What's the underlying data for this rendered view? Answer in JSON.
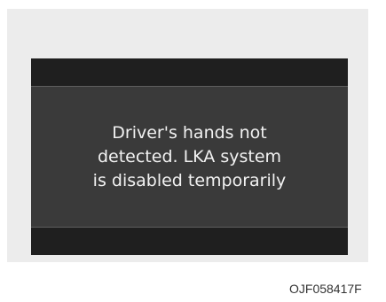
{
  "display": {
    "message_lines": [
      "Driver's hands not",
      "detected. LKA system",
      "is disabled temporarily"
    ]
  },
  "figure_code": "OJF058417F",
  "colors": {
    "panel_background": "#ececec",
    "display_background": "#3a3a3a",
    "display_bars": "#1f1f1f",
    "message_text": "#f2f2f2"
  }
}
